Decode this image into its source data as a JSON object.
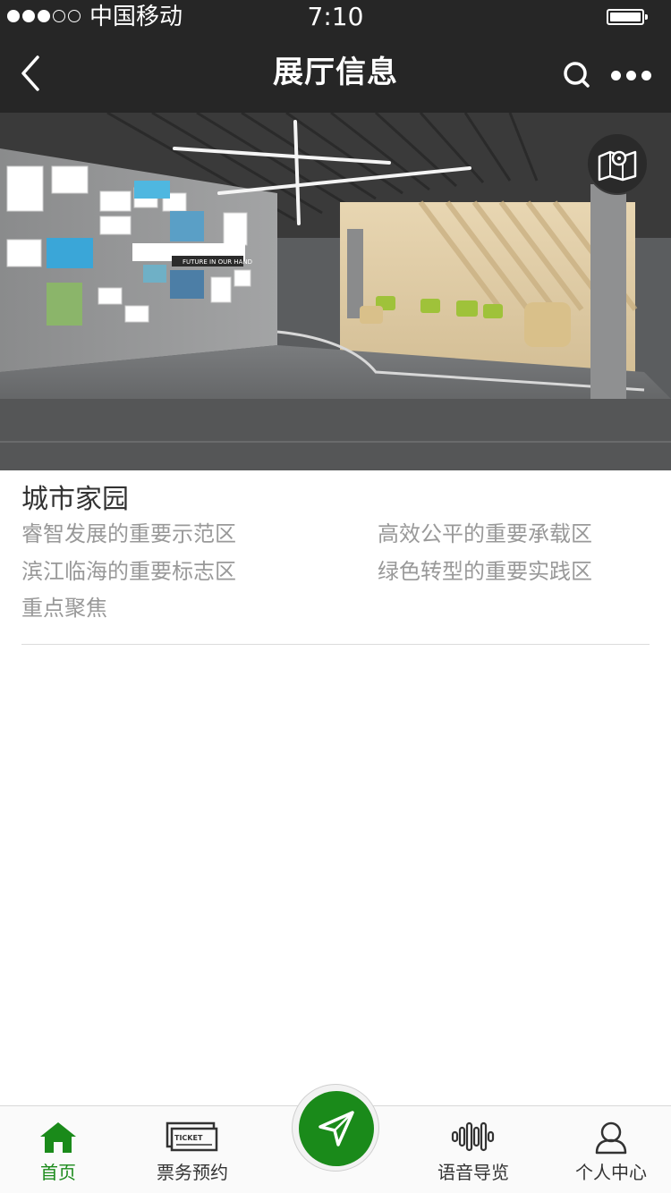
{
  "status_bar": {
    "carrier": "中国移动",
    "time": "7:10",
    "signal_bars_filled": 3,
    "signal_bars_total": 5,
    "battery_level": 1.0
  },
  "nav": {
    "title": "展厅信息",
    "back_icon": "chevron-left-icon",
    "search_icon": "search-icon",
    "more_icon": "more-dots-icon"
  },
  "hero": {
    "image": "exhibition-hall-photo",
    "wall_caption": "FUTURE IN OUR HAND",
    "map_icon": "map-icon"
  },
  "section": {
    "title": "城市家园",
    "links": [
      "睿智发展的重要示范区",
      "高效公平的重要承载区",
      "滨江临海的重要标志区",
      "绿色转型的重要实践区",
      "重点聚焦"
    ]
  },
  "tab_bar": {
    "accent_color": "#1a8a1a",
    "tabs": [
      {
        "label": "首页",
        "icon": "home-icon",
        "active": true
      },
      {
        "label": "票务预约",
        "icon": "ticket-icon",
        "icon_text": "TICKET",
        "active": false
      },
      {
        "label": "",
        "icon": "navigation-arrow-icon",
        "active": false
      },
      {
        "label": "语音导览",
        "icon": "audio-wave-icon",
        "active": false
      },
      {
        "label": "个人中心",
        "icon": "user-icon",
        "active": false
      }
    ]
  }
}
